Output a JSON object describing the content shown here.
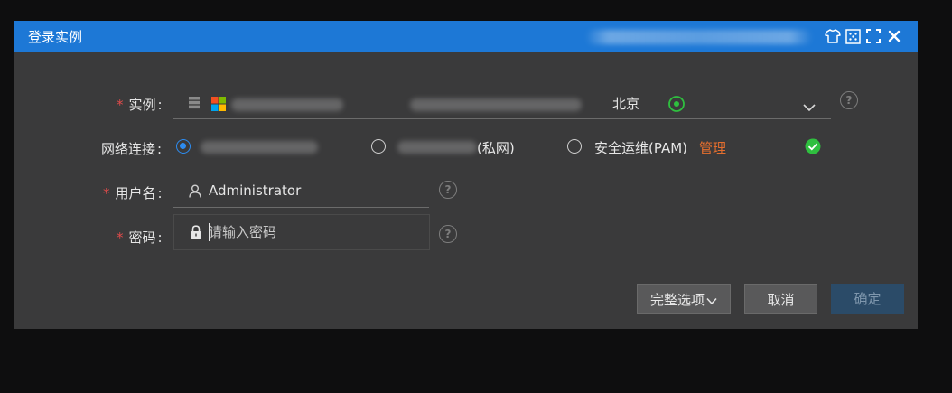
{
  "dialog": {
    "title": "登录实例",
    "titlebar_icons": [
      "shirt-icon",
      "dotted-square-icon",
      "fullscreen-icon",
      "close-icon"
    ]
  },
  "instance": {
    "label": "实例",
    "region": "北京",
    "os_icon": "windows-icon",
    "status_icon": "running-status-icon",
    "chevron": "chevron-down-icon"
  },
  "network": {
    "label": "网络连接",
    "options": [
      {
        "label": "",
        "checked": true
      },
      {
        "label": "(私网)",
        "checked": false
      },
      {
        "label": "安全运维(PAM)",
        "checked": false
      }
    ],
    "manage_link": "管理",
    "status_color": "#2fbf3f"
  },
  "username": {
    "label": "用户名",
    "value": "Administrator"
  },
  "password": {
    "label": "密码",
    "placeholder": "请输入密码"
  },
  "buttons": {
    "options": "完整选项",
    "cancel": "取消",
    "confirm": "确定"
  },
  "colors": {
    "titlebar": "#1d78d6",
    "dialog_bg": "#3a3a3b",
    "required": "#e04b4b",
    "radio_active": "#2d8cf0",
    "link": "#e46e2e"
  }
}
